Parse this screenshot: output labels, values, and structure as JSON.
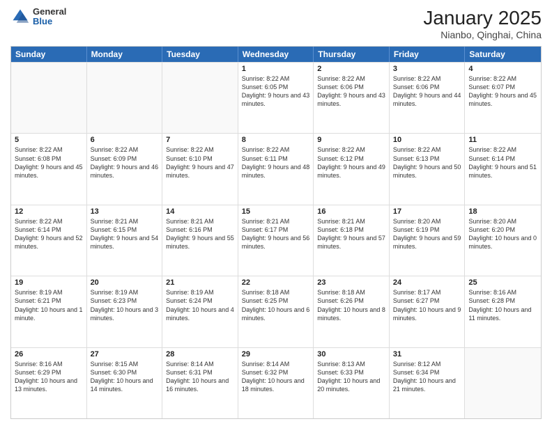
{
  "header": {
    "logo": {
      "general": "General",
      "blue": "Blue"
    },
    "title": "January 2025",
    "location": "Nianbo, Qinghai, China"
  },
  "weekdays": [
    "Sunday",
    "Monday",
    "Tuesday",
    "Wednesday",
    "Thursday",
    "Friday",
    "Saturday"
  ],
  "rows": [
    [
      {
        "day": "",
        "text": ""
      },
      {
        "day": "",
        "text": ""
      },
      {
        "day": "",
        "text": ""
      },
      {
        "day": "1",
        "text": "Sunrise: 8:22 AM\nSunset: 6:05 PM\nDaylight: 9 hours and 43 minutes."
      },
      {
        "day": "2",
        "text": "Sunrise: 8:22 AM\nSunset: 6:06 PM\nDaylight: 9 hours and 43 minutes."
      },
      {
        "day": "3",
        "text": "Sunrise: 8:22 AM\nSunset: 6:06 PM\nDaylight: 9 hours and 44 minutes."
      },
      {
        "day": "4",
        "text": "Sunrise: 8:22 AM\nSunset: 6:07 PM\nDaylight: 9 hours and 45 minutes."
      }
    ],
    [
      {
        "day": "5",
        "text": "Sunrise: 8:22 AM\nSunset: 6:08 PM\nDaylight: 9 hours and 45 minutes."
      },
      {
        "day": "6",
        "text": "Sunrise: 8:22 AM\nSunset: 6:09 PM\nDaylight: 9 hours and 46 minutes."
      },
      {
        "day": "7",
        "text": "Sunrise: 8:22 AM\nSunset: 6:10 PM\nDaylight: 9 hours and 47 minutes."
      },
      {
        "day": "8",
        "text": "Sunrise: 8:22 AM\nSunset: 6:11 PM\nDaylight: 9 hours and 48 minutes."
      },
      {
        "day": "9",
        "text": "Sunrise: 8:22 AM\nSunset: 6:12 PM\nDaylight: 9 hours and 49 minutes."
      },
      {
        "day": "10",
        "text": "Sunrise: 8:22 AM\nSunset: 6:13 PM\nDaylight: 9 hours and 50 minutes."
      },
      {
        "day": "11",
        "text": "Sunrise: 8:22 AM\nSunset: 6:14 PM\nDaylight: 9 hours and 51 minutes."
      }
    ],
    [
      {
        "day": "12",
        "text": "Sunrise: 8:22 AM\nSunset: 6:14 PM\nDaylight: 9 hours and 52 minutes."
      },
      {
        "day": "13",
        "text": "Sunrise: 8:21 AM\nSunset: 6:15 PM\nDaylight: 9 hours and 54 minutes."
      },
      {
        "day": "14",
        "text": "Sunrise: 8:21 AM\nSunset: 6:16 PM\nDaylight: 9 hours and 55 minutes."
      },
      {
        "day": "15",
        "text": "Sunrise: 8:21 AM\nSunset: 6:17 PM\nDaylight: 9 hours and 56 minutes."
      },
      {
        "day": "16",
        "text": "Sunrise: 8:21 AM\nSunset: 6:18 PM\nDaylight: 9 hours and 57 minutes."
      },
      {
        "day": "17",
        "text": "Sunrise: 8:20 AM\nSunset: 6:19 PM\nDaylight: 9 hours and 59 minutes."
      },
      {
        "day": "18",
        "text": "Sunrise: 8:20 AM\nSunset: 6:20 PM\nDaylight: 10 hours and 0 minutes."
      }
    ],
    [
      {
        "day": "19",
        "text": "Sunrise: 8:19 AM\nSunset: 6:21 PM\nDaylight: 10 hours and 1 minute."
      },
      {
        "day": "20",
        "text": "Sunrise: 8:19 AM\nSunset: 6:23 PM\nDaylight: 10 hours and 3 minutes."
      },
      {
        "day": "21",
        "text": "Sunrise: 8:19 AM\nSunset: 6:24 PM\nDaylight: 10 hours and 4 minutes."
      },
      {
        "day": "22",
        "text": "Sunrise: 8:18 AM\nSunset: 6:25 PM\nDaylight: 10 hours and 6 minutes."
      },
      {
        "day": "23",
        "text": "Sunrise: 8:18 AM\nSunset: 6:26 PM\nDaylight: 10 hours and 8 minutes."
      },
      {
        "day": "24",
        "text": "Sunrise: 8:17 AM\nSunset: 6:27 PM\nDaylight: 10 hours and 9 minutes."
      },
      {
        "day": "25",
        "text": "Sunrise: 8:16 AM\nSunset: 6:28 PM\nDaylight: 10 hours and 11 minutes."
      }
    ],
    [
      {
        "day": "26",
        "text": "Sunrise: 8:16 AM\nSunset: 6:29 PM\nDaylight: 10 hours and 13 minutes."
      },
      {
        "day": "27",
        "text": "Sunrise: 8:15 AM\nSunset: 6:30 PM\nDaylight: 10 hours and 14 minutes."
      },
      {
        "day": "28",
        "text": "Sunrise: 8:14 AM\nSunset: 6:31 PM\nDaylight: 10 hours and 16 minutes."
      },
      {
        "day": "29",
        "text": "Sunrise: 8:14 AM\nSunset: 6:32 PM\nDaylight: 10 hours and 18 minutes."
      },
      {
        "day": "30",
        "text": "Sunrise: 8:13 AM\nSunset: 6:33 PM\nDaylight: 10 hours and 20 minutes."
      },
      {
        "day": "31",
        "text": "Sunrise: 8:12 AM\nSunset: 6:34 PM\nDaylight: 10 hours and 21 minutes."
      },
      {
        "day": "",
        "text": ""
      }
    ]
  ]
}
